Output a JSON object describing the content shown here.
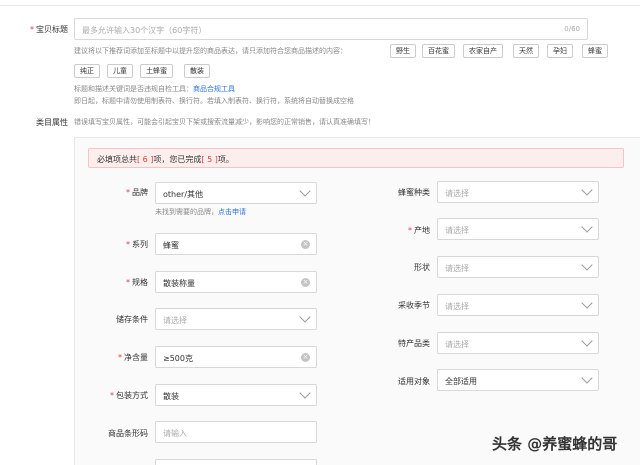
{
  "title_field": {
    "label": "宝贝标题",
    "placeholder": "最多允许输入30个汉字（60字符）",
    "counter": "0/60",
    "hint": "建议将以下推荐词添加至标题中以提升您的商品表达，请只添加符合您商品描述的内容：",
    "tags": [
      "野生",
      "百花蜜",
      "农家自产",
      "天然",
      "孕妇",
      "蜂蜜",
      "纯正",
      "儿童",
      "土蜂蜜",
      "散装"
    ],
    "note1_prefix": "标题和描述关键词是否违规自检工具：",
    "note1_link": "商品合规工具",
    "note2": "即日起，标题中请勿使用制表符、换行符。若填入制表符、换行符，系统将自动替换成空格"
  },
  "category": {
    "label": "类目属性",
    "hint": "错误填写宝贝属性，可能会引起宝贝下架或搜索流量减少，影响您的正常销售，请认真准确填写！"
  },
  "alert": {
    "prefix": "必填项总共",
    "total": "[ 6 ]",
    "middle": "项，您已完成",
    "done": "[ 5 ]",
    "suffix": "项。"
  },
  "left_fields": [
    {
      "label": "品牌",
      "required": true,
      "value": "other/其他",
      "placeholder": "",
      "control": "select"
    },
    {
      "label": "系列",
      "required": true,
      "value": "蜂蜜",
      "placeholder": "",
      "control": "clear"
    },
    {
      "label": "规格",
      "required": true,
      "value": "散装称量",
      "placeholder": "",
      "control": "clear"
    },
    {
      "label": "储存条件",
      "required": false,
      "value": "",
      "placeholder": "请选择",
      "control": "select"
    },
    {
      "label": "净含量",
      "required": true,
      "value": "≥500克",
      "placeholder": "",
      "control": "clear"
    },
    {
      "label": "包装方式",
      "required": true,
      "value": "散装",
      "placeholder": "",
      "control": "select"
    },
    {
      "label": "商品条形码",
      "required": false,
      "value": "",
      "placeholder": "请输入",
      "control": "none"
    }
  ],
  "brand_hint": {
    "prefix": "未找到需要的品牌，",
    "link": "点击申请"
  },
  "right_fields": [
    {
      "label": "蜂蜜种类",
      "required": false,
      "value": "",
      "placeholder": "请选择"
    },
    {
      "label": "产地",
      "required": true,
      "value": "",
      "placeholder": "请选择"
    },
    {
      "label": "形状",
      "required": false,
      "value": "",
      "placeholder": "请选择"
    },
    {
      "label": "采收季节",
      "required": false,
      "value": "",
      "placeholder": "请选择"
    },
    {
      "label": "特产品类",
      "required": false,
      "value": "",
      "placeholder": "请选择"
    },
    {
      "label": "适用对象",
      "required": false,
      "value": "全部适用",
      "placeholder": ""
    }
  ],
  "watermark": "头条 @养蜜蜂的哥",
  "colors": {
    "required": "#e4393c",
    "link": "#2b73d8",
    "alert_bg": "#fdeeee"
  }
}
